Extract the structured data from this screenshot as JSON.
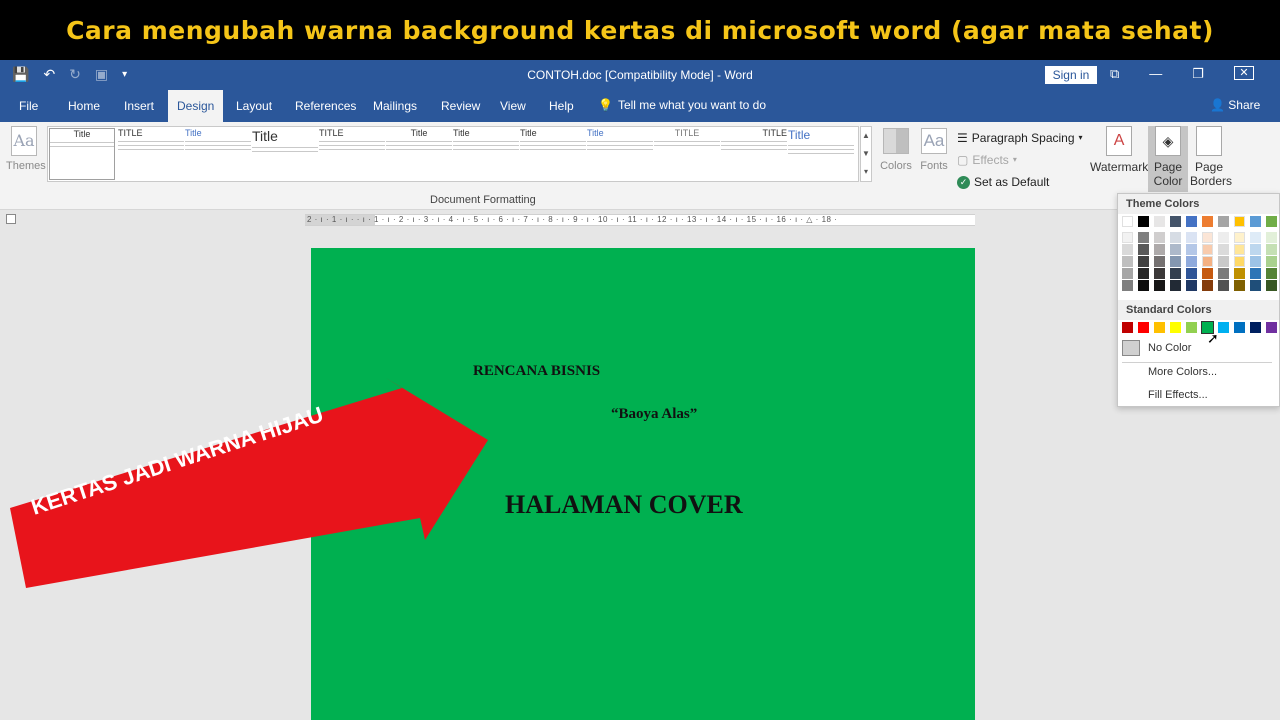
{
  "banner": {
    "text": "Cara mengubah warna background kertas di microsoft word (agar mata sehat)"
  },
  "titlebar": {
    "title": "CONTOH.doc [Compatibility Mode] - Word",
    "signin": "Sign in"
  },
  "tabs": [
    {
      "label": "File"
    },
    {
      "label": "Home"
    },
    {
      "label": "Insert"
    },
    {
      "label": "Design"
    },
    {
      "label": "Layout"
    },
    {
      "label": "References"
    },
    {
      "label": "Mailings"
    },
    {
      "label": "Review"
    },
    {
      "label": "View"
    },
    {
      "label": "Help"
    }
  ],
  "tellme": "Tell me what you want to do",
  "share": "Share",
  "ribbon": {
    "themes": "Themes",
    "gallery_label": "Document Formatting",
    "styles": [
      {
        "title": "Title"
      },
      {
        "title": "TITLE"
      },
      {
        "title": "Title"
      },
      {
        "title": "Title"
      },
      {
        "title": "TITLE"
      },
      {
        "title": "Title"
      },
      {
        "title": "Title"
      },
      {
        "title": "Title"
      },
      {
        "title": "Title"
      },
      {
        "title": "TITLE"
      },
      {
        "title": "TITLE"
      },
      {
        "title": "Title"
      }
    ],
    "colors": "Colors",
    "fonts": "Fonts",
    "paragraph_spacing": "Paragraph Spacing",
    "effects": "Effects",
    "set_default": "Set as Default",
    "watermark": "Watermark",
    "page_color_line1": "Page",
    "page_color_line2": "Color",
    "page_borders_line1": "Page",
    "page_borders_line2": "Borders"
  },
  "ruler_text": "2 · ı · 1 · ı ·   · ı · 1 · ı · 2 · ı · 3 · ı · 4 · ı · 5 · ı · 6 · ı · 7 · ı · 8 · ı · 9 · ı · 10 · ı · 11 · ı · 12 · ı · 13 · ı · 14 · ı · 15 · ı · 16 · ı · △ · 18 ·",
  "document": {
    "line1": "RENCANA BISNIS",
    "line2": "“Baoya Alas”",
    "line3": "HALAMAN COVER",
    "page_color": "#00b050"
  },
  "dropdown": {
    "theme_colors": "Theme Colors",
    "standard_colors": "Standard Colors",
    "no_color": "No Color",
    "more_colors": "More Colors...",
    "fill_effects": "Fill Effects..."
  },
  "arrow": {
    "text": "KERTAS JADI WARNA HIJAU",
    "color": "#e8141b"
  },
  "colors": {
    "title_blue": "#2b579a",
    "banner_yellow": "#f5c518"
  }
}
